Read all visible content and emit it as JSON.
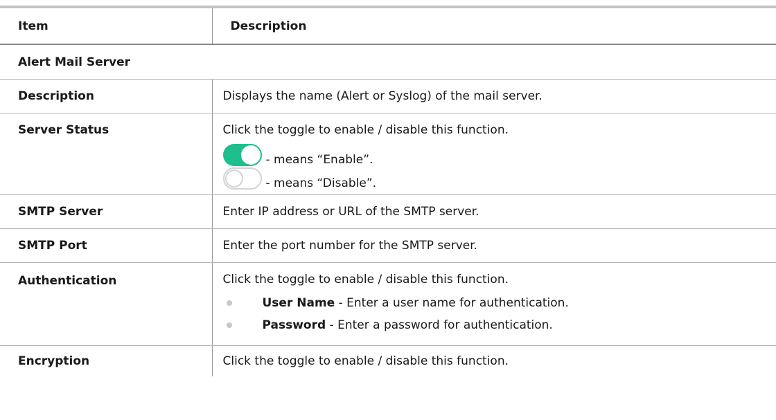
{
  "table": {
    "headers": {
      "item": "Item",
      "description": "Description"
    },
    "section_title": "Alert Mail Server",
    "rows": {
      "description": {
        "item": "Description",
        "text": "Displays the name (Alert or Syslog) of the mail server."
      },
      "server_status": {
        "item": "Server Status",
        "text": "Click the toggle to enable / disable this function.",
        "enable_label": "- means “Enable”.",
        "disable_label": "- means “Disable”."
      },
      "smtp_server": {
        "item": "SMTP Server",
        "text": "Enter IP address or URL of the SMTP server."
      },
      "smtp_port": {
        "item": "SMTP Port",
        "text": "Enter the port number for the SMTP server."
      },
      "authentication": {
        "item": "Authentication",
        "text": "Click the toggle to enable / disable this function.",
        "bullets": [
          {
            "term": "User Name",
            "text": " - Enter a user name for authentication."
          },
          {
            "term": "Password",
            "text": " - Enter a password for authentication."
          }
        ]
      },
      "encryption": {
        "item": "Encryption",
        "text": "Click the toggle to enable / disable this function."
      }
    }
  },
  "colors": {
    "toggle_on": "#1dbf8d",
    "toggle_off_border": "#d4d4d4",
    "bullet": "#c8c8c8"
  },
  "icons": {
    "toggle_enabled": "toggle-on-icon",
    "toggle_disabled": "toggle-off-icon",
    "bullet": "bullet-dot-icon"
  }
}
